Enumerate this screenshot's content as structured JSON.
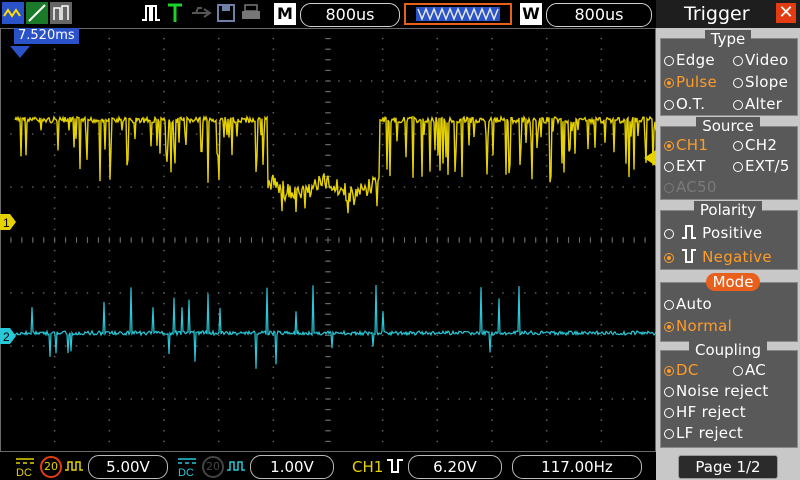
{
  "topbar": {
    "timebase_label": "M",
    "timebase_value": "800us",
    "window_label": "W",
    "window_value": "800us"
  },
  "screen": {
    "time_offset": "7.520ms",
    "ch1_marker": "1",
    "ch2_marker": "2",
    "ch1_color": "#e6d200",
    "ch2_color": "#28c8d8"
  },
  "bottombar": {
    "ch1_volts": "5.00V",
    "ch2_volts": "1.00V",
    "trigger_source": "CH1",
    "trigger_level": "6.20V",
    "frequency": "117.00Hz",
    "bw_limit": "20"
  },
  "panel": {
    "title": "Trigger",
    "type_heading": "Type",
    "type_options": [
      "Edge",
      "Video",
      "Pulse",
      "Slope",
      "O.T.",
      "Alter"
    ],
    "source_heading": "Source",
    "source_options": [
      "CH1",
      "CH2",
      "EXT",
      "EXT/5",
      "AC50"
    ],
    "polarity_heading": "Polarity",
    "polarity_options": [
      "Positive",
      "Negative"
    ],
    "mode_heading": "Mode",
    "mode_options": [
      "Auto",
      "Normal"
    ],
    "coupling_heading": "Coupling",
    "coupling_options": [
      "DC",
      "AC",
      "Noise reject",
      "HF reject",
      "LF reject"
    ],
    "page": "Page 1/2",
    "accent": "#ff9b28"
  }
}
